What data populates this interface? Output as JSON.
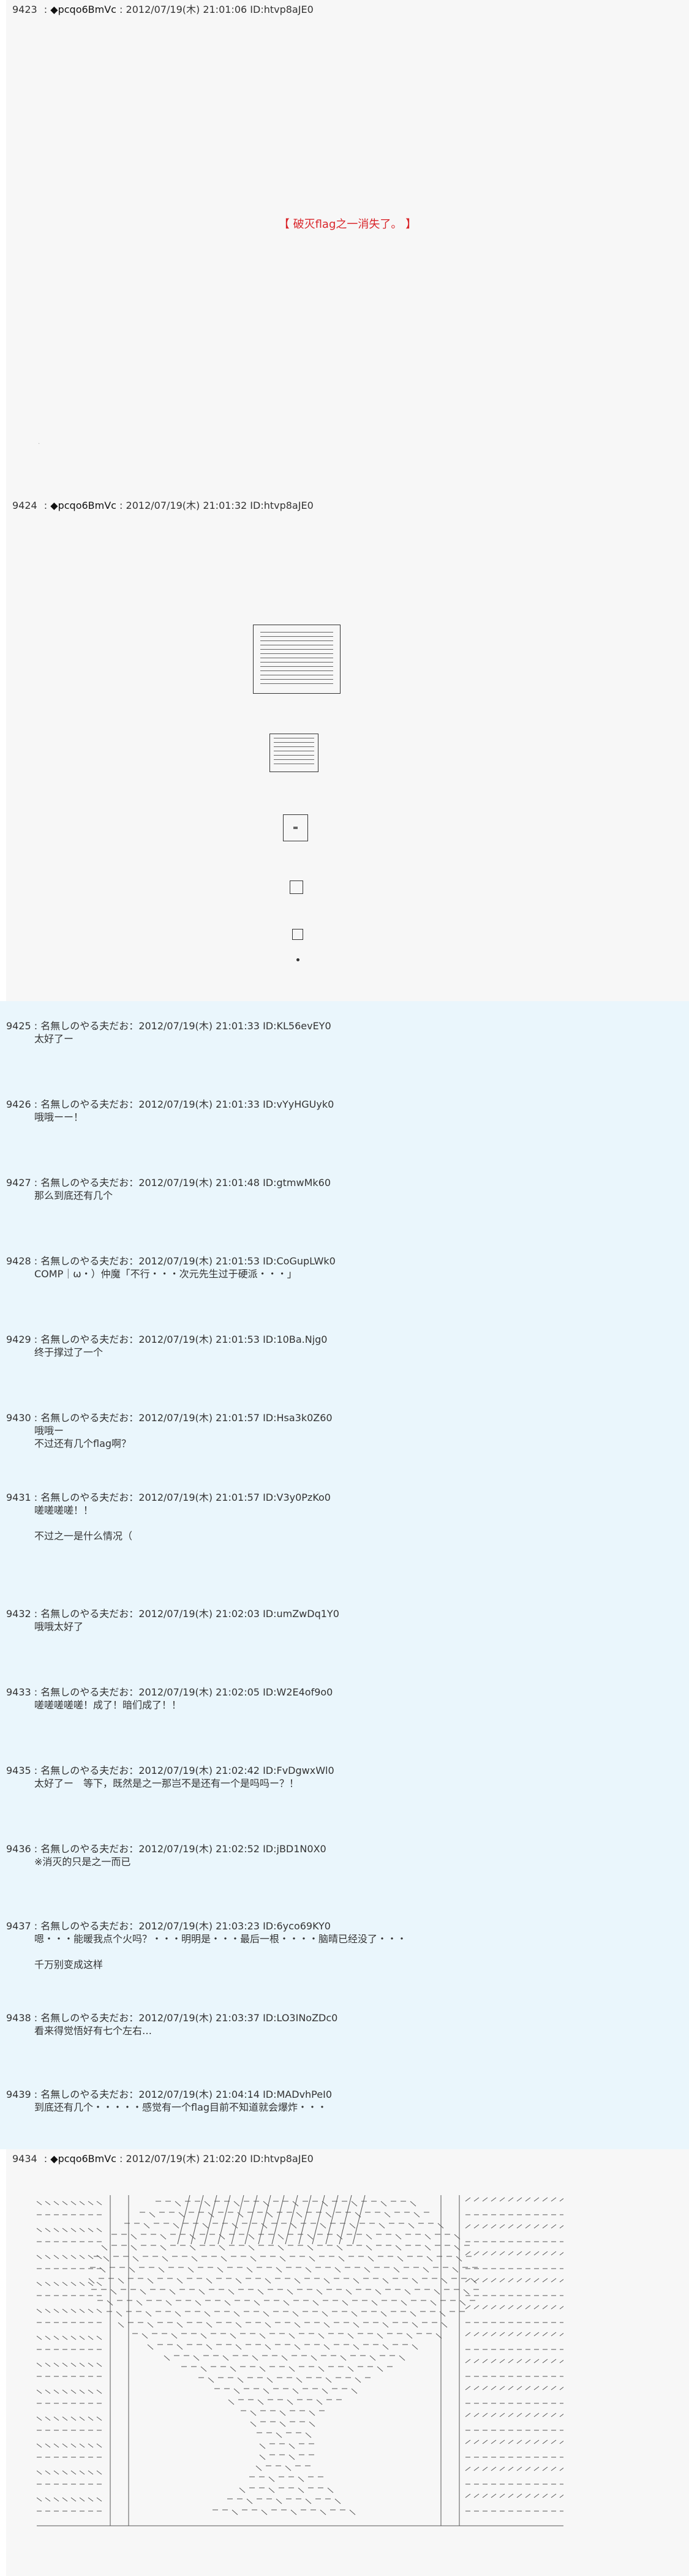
{
  "posts": {
    "p9423": {
      "number": "9423",
      "name": "◆pcqo6BmVc",
      "datetime": "2012/07/19(木) 21:01:06",
      "id": "ID:htvp8aJE0",
      "message": "【 破灭flag之一消失了。 】"
    },
    "p9424": {
      "number": "9424",
      "name": "◆pcqo6BmVc",
      "datetime": "2012/07/19(木) 21:01:32",
      "id": "ID:htvp8aJE0"
    },
    "p9434": {
      "number": "9434",
      "name": "◆pcqo6BmVc",
      "datetime": "2012/07/19(木) 21:02:20",
      "id": "ID:htvp8aJE0"
    }
  },
  "replies": [
    {
      "number": "9425",
      "name": "名無しのやる夫だお",
      "datetime": "2012/07/19(木) 21:01:33",
      "id": "ID:KL56evEY0",
      "lines": [
        "太好了ー"
      ]
    },
    {
      "number": "9426",
      "name": "名無しのやる夫だお",
      "datetime": "2012/07/19(木) 21:01:33",
      "id": "ID:vYyHGUyk0",
      "lines": [
        "哦哦ーー！"
      ]
    },
    {
      "number": "9427",
      "name": "名無しのやる夫だお",
      "datetime": "2012/07/19(木) 21:01:48",
      "id": "ID:gtmwMk60",
      "lines": [
        "那么到底还有几个"
      ]
    },
    {
      "number": "9428",
      "name": "名無しのやる夫だお",
      "datetime": "2012/07/19(木) 21:01:53",
      "id": "ID:CoGupLWk0",
      "lines": [
        "COMP｜ω・）仲魔「不行・・・次元先生过于硬派・・・」"
      ]
    },
    {
      "number": "9429",
      "name": "名無しのやる夫だお",
      "datetime": "2012/07/19(木) 21:01:53",
      "id": "ID:10Ba.Njg0",
      "lines": [
        "终于撑过了一个"
      ]
    },
    {
      "number": "9430",
      "name": "名無しのやる夫だお",
      "datetime": "2012/07/19(木) 21:01:57",
      "id": "ID:Hsa3k0Z60",
      "lines": [
        "哦哦ー",
        "不过还有几个flag啊？"
      ]
    },
    {
      "number": "9431",
      "name": "名無しのやる夫だお",
      "datetime": "2012/07/19(木) 21:01:57",
      "id": "ID:V3y0PzKo0",
      "lines": [
        "嗟嗟嗟嗟！！",
        "",
        "不过之一是什么情况（"
      ]
    },
    {
      "number": "9432",
      "name": "名無しのやる夫だお",
      "datetime": "2012/07/19(木) 21:02:03",
      "id": "ID:umZwDq1Y0",
      "lines": [
        "哦哦太好了"
      ]
    },
    {
      "number": "9433",
      "name": "名無しのやる夫だお",
      "datetime": "2012/07/19(木) 21:02:05",
      "id": "ID:W2E4of9o0",
      "lines": [
        "嗟嗟嗟嗟嗟！成了！暗们成了！！"
      ]
    },
    {
      "number": "9435",
      "name": "名無しのやる夫だお",
      "datetime": "2012/07/19(木) 21:02:42",
      "id": "ID:FvDgwxWl0",
      "lines": [
        "太好了ー　等下，既然是之一那岂不是还有一个是吗吗ー？！"
      ]
    },
    {
      "number": "9436",
      "name": "名無しのやる夫だお",
      "datetime": "2012/07/19(木) 21:02:52",
      "id": "ID:jBD1N0X0",
      "lines": [
        "※消灭的只是之一而已"
      ]
    },
    {
      "number": "9437",
      "name": "名無しのやる夫だお",
      "datetime": "2012/07/19(木) 21:03:23",
      "id": "ID:6yco69KY0",
      "lines": [
        "嗯・・・能暖我点个火吗？・・・明明是・・・最后一根・・・・脑晴已经没了・・・",
        "",
        "千万别变成这样"
      ]
    },
    {
      "number": "9438",
      "name": "名無しのやる夫だお",
      "datetime": "2012/07/19(木) 21:03:37",
      "id": "ID:LO3INoZDc0",
      "lines": [
        "看来得觉悟好有七个左右…"
      ]
    },
    {
      "number": "9439",
      "name": "名無しのやる夫だお",
      "datetime": "2012/07/19(木) 21:04:14",
      "id": "ID:MADvhPeI0",
      "lines": [
        "到底还有几个・・・・・感觉有一个flag目前不知道就会爆炸・・・"
      ]
    }
  ],
  "colors": {
    "reply_bg": "#eaf6fc",
    "author_bg": "#f7f7f7",
    "message_red": "#d9262b"
  },
  "icons": {
    "boxes": "shrinking-frame-icon",
    "aa": "ascii-art-figure"
  }
}
